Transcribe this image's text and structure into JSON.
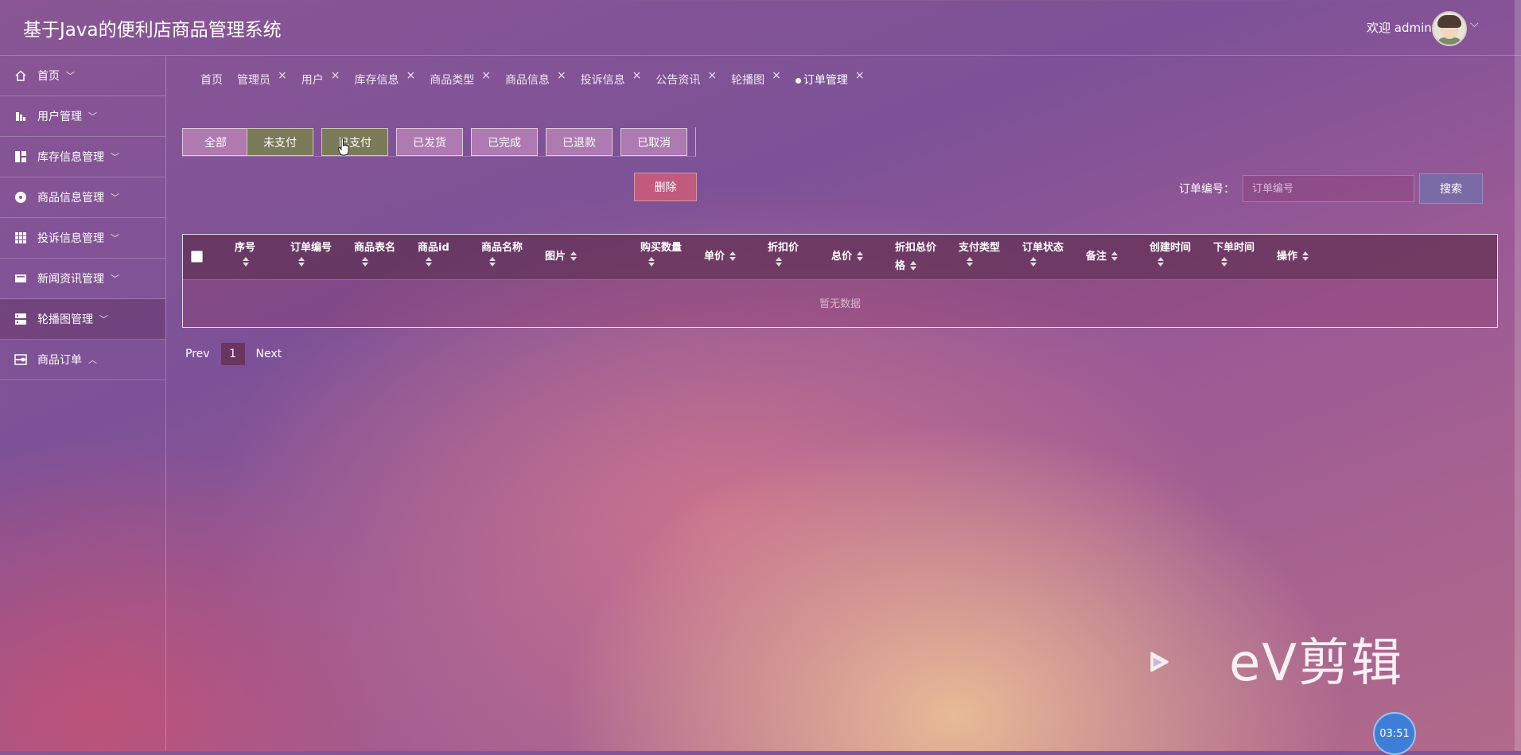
{
  "header": {
    "title": "基于Java的便利店商品管理系统",
    "welcome": "欢迎 admin"
  },
  "sidebar": {
    "items": [
      {
        "label": "首页",
        "icon": "home-icon",
        "chevron": "down"
      },
      {
        "label": "用户管理",
        "icon": "users-chart-icon",
        "chevron": "down"
      },
      {
        "label": "库存信息管理",
        "icon": "dashboard-grid-icon",
        "chevron": "down"
      },
      {
        "label": "商品信息管理",
        "icon": "circle-dot-icon",
        "chevron": "down"
      },
      {
        "label": "投诉信息管理",
        "icon": "apps-grid-icon",
        "chevron": "down"
      },
      {
        "label": "新闻资讯管理",
        "icon": "news-icon",
        "chevron": "down"
      },
      {
        "label": "轮播图管理",
        "icon": "server-icon",
        "chevron": "down",
        "active": true
      },
      {
        "label": "商品订单",
        "icon": "order-toggle-icon",
        "chevron": "up"
      }
    ]
  },
  "tabs": [
    {
      "label": "首页",
      "closable": false
    },
    {
      "label": "管理员",
      "closable": true
    },
    {
      "label": "用户",
      "closable": true
    },
    {
      "label": "库存信息",
      "closable": true
    },
    {
      "label": "商品类型",
      "closable": true
    },
    {
      "label": "商品信息",
      "closable": true
    },
    {
      "label": "投诉信息",
      "closable": true
    },
    {
      "label": "公告资讯",
      "closable": true
    },
    {
      "label": "轮播图",
      "closable": true
    },
    {
      "label": "订单管理",
      "closable": true,
      "active": true
    }
  ],
  "status_filters": [
    {
      "label": "全部",
      "style": "light"
    },
    {
      "label": "未支付",
      "style": "olive"
    },
    {
      "label": "已支付",
      "style": "olive"
    },
    {
      "label": "已发货",
      "style": "light"
    },
    {
      "label": "已完成",
      "style": "light"
    },
    {
      "label": "已退款",
      "style": "light"
    },
    {
      "label": "已取消",
      "style": "light"
    }
  ],
  "actions": {
    "delete_label": "删除"
  },
  "search": {
    "label": "订单编号：",
    "placeholder": "订单编号",
    "button_label": "搜索"
  },
  "table": {
    "columns": [
      {
        "line1": "序号",
        "line2": ""
      },
      {
        "line1": "订单编号",
        "line2": ""
      },
      {
        "line1": "商品表名",
        "line2": ""
      },
      {
        "line1": "商品id",
        "line2": ""
      },
      {
        "line1": "商品名称",
        "line2": ""
      },
      {
        "line1": "图片",
        "line2": ""
      },
      {
        "line1": "购买数量",
        "line2": ""
      },
      {
        "line1": "单价",
        "line2": ""
      },
      {
        "line1": "折扣价",
        "line2": ""
      },
      {
        "line1": "总价",
        "line2": ""
      },
      {
        "line1": "折扣总价",
        "line2": "格"
      },
      {
        "line1": "支付类型",
        "line2": ""
      },
      {
        "line1": "订单状态",
        "line2": ""
      },
      {
        "line1": "备注",
        "line2": ""
      },
      {
        "line1": "创建时间",
        "line2": ""
      },
      {
        "line1": "下单时间",
        "line2": ""
      },
      {
        "line1": "操作",
        "line2": ""
      }
    ],
    "empty_text": "暂无数据"
  },
  "pagination": {
    "prev": "Prev",
    "current": "1",
    "next": "Next"
  },
  "watermark": {
    "text": "eV剪辑",
    "timer": "03:51"
  },
  "colors": {
    "olive": "#7b7a59",
    "delete": "#c15a7c",
    "search": "#7a6aa5"
  }
}
